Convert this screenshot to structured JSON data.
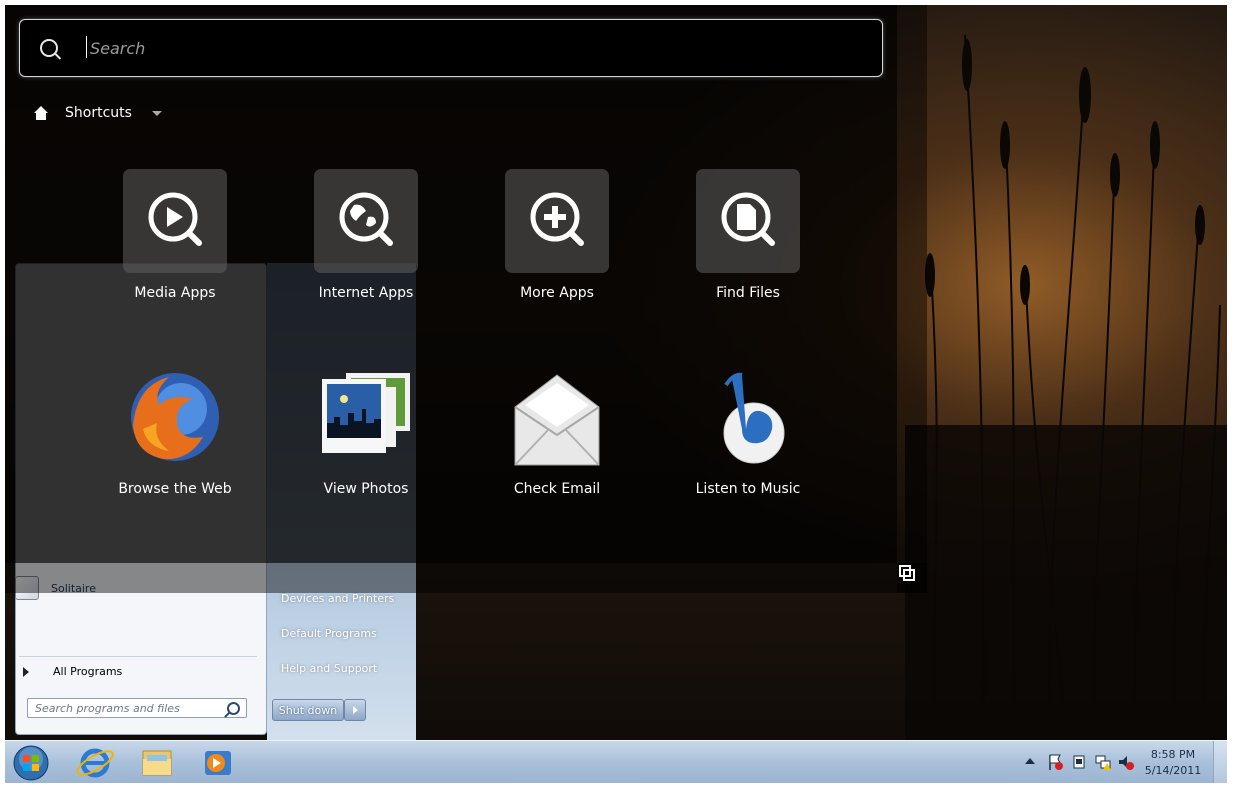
{
  "launcher": {
    "search_placeholder": "Search",
    "section_label": "Shortcuts",
    "tiles": [
      {
        "label": "Media Apps",
        "icon": "play-magnifier-icon"
      },
      {
        "label": "Internet Apps",
        "icon": "globe-magnifier-icon"
      },
      {
        "label": "More Apps",
        "icon": "plus-magnifier-icon"
      },
      {
        "label": "Find Files",
        "icon": "file-magnifier-icon"
      }
    ],
    "apps": [
      {
        "label": "Browse the Web",
        "icon": "firefox-icon"
      },
      {
        "label": "View Photos",
        "icon": "photos-icon"
      },
      {
        "label": "Check Email",
        "icon": "envelope-icon"
      },
      {
        "label": "Listen to Music",
        "icon": "music-note-icon"
      }
    ]
  },
  "start_menu": {
    "solitaire": "Solitaire",
    "all_programs": "All Programs",
    "search_placeholder": "Search programs and files",
    "right_links": [
      "Devices and Printers",
      "Default Programs",
      "Help and Support"
    ],
    "shutdown": "Shut down"
  },
  "taskbar": {
    "time": "8:58 PM",
    "date": "5/14/2011"
  }
}
